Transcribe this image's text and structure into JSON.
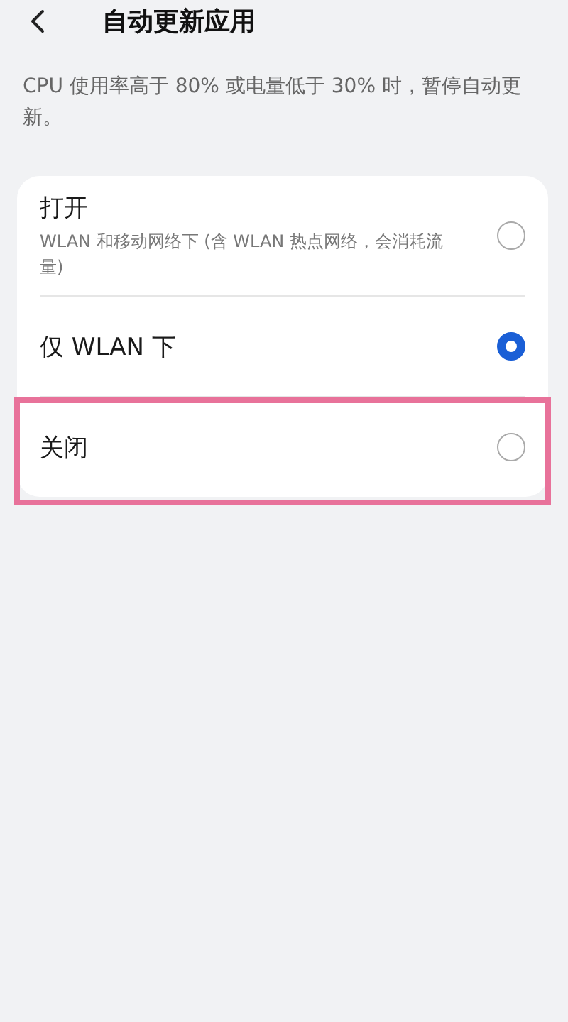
{
  "header": {
    "title": "自动更新应用"
  },
  "description": "CPU 使用率高于 80% 或电量低于 30% 时，暂停自动更新。",
  "options": [
    {
      "label": "打开",
      "subtitle": "WLAN 和移动网络下 (含 WLAN 热点网络，会消耗流量)",
      "selected": false,
      "highlighted": false
    },
    {
      "label": "仅 WLAN 下",
      "selected": true,
      "highlighted": false
    },
    {
      "label": "关闭",
      "selected": false,
      "highlighted": true
    }
  ]
}
